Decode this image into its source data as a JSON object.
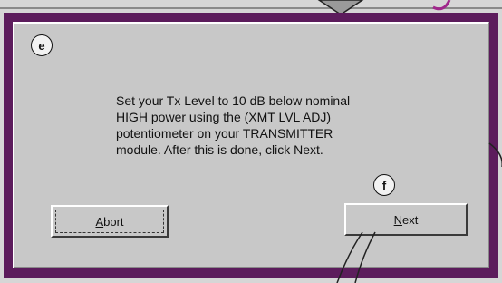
{
  "callouts": {
    "e": "e",
    "f": "f"
  },
  "message": "Set your Tx Level to 10 dB below nominal\nHIGH power using the (XMT LVL ADJ)\npotentiometer on your TRANSMITTER\nmodule. After this is done, click Next.",
  "buttons": {
    "abort": {
      "accel": "A",
      "rest": "bort"
    },
    "next": {
      "accel": "N",
      "rest": "ext"
    }
  },
  "colors": {
    "frame_border": "#5c1c5c",
    "dialog_bg": "#c8c8c8",
    "accent_magenta": "#a0288c"
  }
}
